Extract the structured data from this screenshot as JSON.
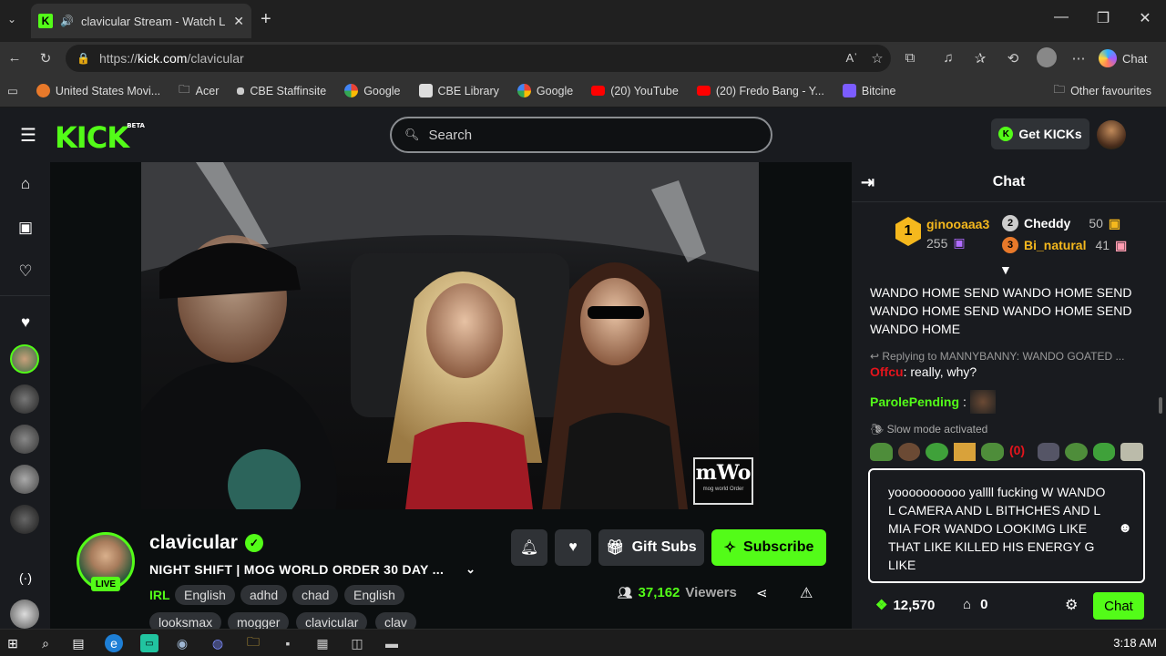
{
  "browser": {
    "tab_title": "clavicular Stream - Watch Live",
    "url_prefix": "https://",
    "url_host": "kick.com",
    "url_path": "/clavicular",
    "copilot_label": "Chat",
    "bookmarks": [
      "United States Movi...",
      "Acer",
      "CBE Staffinsite",
      "Google",
      "CBE Library",
      "Google",
      "(20) YouTube",
      "(20) Fredo Bang - Y...",
      "Bitcine",
      "Other favourites"
    ]
  },
  "kick": {
    "logo": "KICK",
    "logo_badge": "BETA",
    "search_placeholder": "Search",
    "get_kicks": "Get KICKs"
  },
  "stream": {
    "channel": "clavicular",
    "live_badge": "LIVE",
    "title": "NIGHT SHIFT | MOG WORLD ORDER 30 DAY ...",
    "category": "IRL",
    "tags": [
      "English",
      "adhd",
      "chad",
      "English",
      "looksmax",
      "mogger",
      "clavicular",
      "clav"
    ],
    "gift_subs": "Gift Subs",
    "subscribe": "Subscribe",
    "viewers_count": "37,162",
    "viewers_label": "Viewers",
    "watermark": "mWo",
    "watermark_sub": "mog world Order"
  },
  "chat": {
    "title": "Chat",
    "leaderboard": {
      "first": {
        "rank": "1",
        "name": "ginooaaa3",
        "value": "255"
      },
      "second": {
        "rank": "2",
        "name": "Cheddy",
        "value": "50"
      },
      "third": {
        "rank": "3",
        "name": "Bi_natural",
        "value": "41"
      }
    },
    "messages": {
      "spam": "WANDO HOME SEND WANDO HOME SEND WANDO HOME SEND WANDO HOME SEND WANDO HOME",
      "reply_ref": "Replying to MANNYBANNY: WANDO GOATED ...",
      "offcu_user": "Offcu",
      "offcu_text": ": really, why?",
      "parole_user": "ParolePending",
      "parole_sep": ":",
      "slow_mode": "Slow mode activated"
    },
    "input_text": "yoooooooooo yallll fucking W WANDO L CAMERA AND L BITHCHES AND L MIA FOR WANDO LOOKIMG LIKE THAT LIKE KILLED HIS ENERGY G LIKE",
    "points": "12,570",
    "store_count": "0",
    "send_label": "Chat"
  },
  "taskbar": {
    "time": "3:18 AM"
  },
  "colors": {
    "kick_green": "#53fc18",
    "bg": "#0b0e0f",
    "panel": "#191b1f"
  }
}
